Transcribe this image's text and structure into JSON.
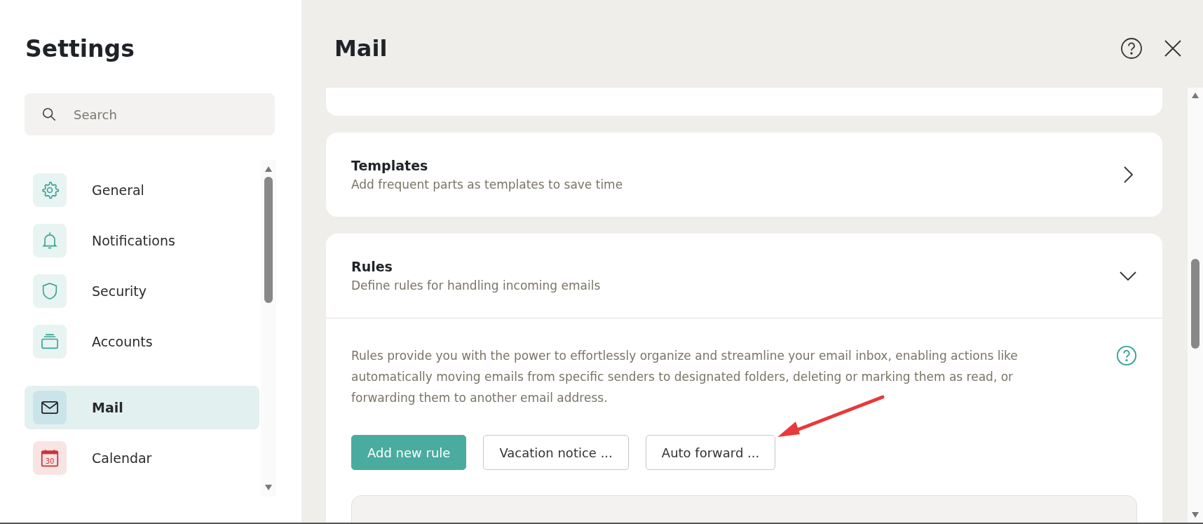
{
  "sidebar": {
    "title": "Settings",
    "search": {
      "placeholder": "Search"
    },
    "items": [
      {
        "label": "General",
        "selected": false
      },
      {
        "label": "Notifications",
        "selected": false
      },
      {
        "label": "Security",
        "selected": false
      },
      {
        "label": "Accounts",
        "selected": false
      },
      {
        "label": "Mail",
        "selected": true
      },
      {
        "label": "Calendar",
        "selected": false,
        "icon_text": "30"
      }
    ]
  },
  "main": {
    "title": "Mail",
    "cards": [
      {
        "title": "Templates",
        "description": "Add frequent parts as templates to save time",
        "expanded": false
      },
      {
        "title": "Rules",
        "description": "Define rules for handling incoming emails",
        "expanded": true,
        "body": {
          "text": "Rules provide you with the power to effortlessly organize and streamline your email inbox, enabling actions like automatically moving emails from specific senders to designated folders, deleting or marking them as read, or forwarding them to another email address.",
          "buttons": [
            {
              "label": "Add new rule",
              "primary": true
            },
            {
              "label": "Vacation notice ...",
              "primary": false
            },
            {
              "label": "Auto forward ...",
              "primary": false
            }
          ]
        }
      }
    ]
  }
}
